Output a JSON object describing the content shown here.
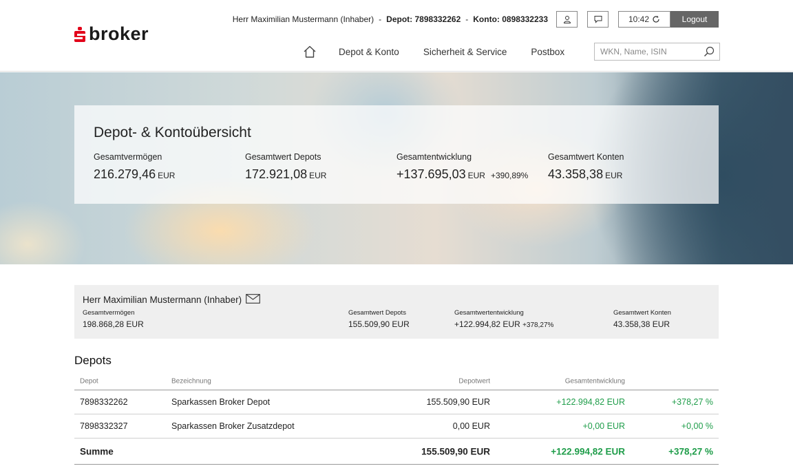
{
  "header": {
    "logo_text": "broker",
    "user_label": "Herr Maximilian Mustermann (Inhaber)",
    "depot_label": "Depot:",
    "depot_number": "7898332262",
    "konto_label": "Konto:",
    "konto_number": "0898332233",
    "separator": "-",
    "session_time": "10:42",
    "logout_label": "Logout",
    "nav": [
      "Depot & Konto",
      "Sicherheit & Service",
      "Postbox"
    ],
    "search_placeholder": "WKN, Name, ISIN"
  },
  "overview": {
    "title": "Depot- & Kontoübersicht",
    "metrics": [
      {
        "label": "Gesamtvermögen",
        "value": "216.279,46",
        "currency": "EUR"
      },
      {
        "label": "Gesamtwert Depots",
        "value": "172.921,08",
        "currency": "EUR"
      },
      {
        "label": "Gesamtentwicklung",
        "value": "+137.695,03",
        "currency": "EUR",
        "percent": "+390,89%"
      },
      {
        "label": "Gesamtwert Konten",
        "value": "43.358,38",
        "currency": "EUR"
      }
    ]
  },
  "owner": {
    "name": "Herr Maximilian Mustermann (Inhaber)",
    "metrics": [
      {
        "label": "Gesamtvermögen",
        "value": "198.868,28 EUR"
      },
      {
        "label": "Gesamtwert Depots",
        "value": "155.509,90 EUR"
      },
      {
        "label": "Gesamtwertentwicklung",
        "value": "+122.994,82 EUR",
        "percent": "+378,27%"
      },
      {
        "label": "Gesamtwert Konten",
        "value": "43.358,38 EUR"
      }
    ]
  },
  "depots": {
    "title": "Depots",
    "columns": [
      "Depot",
      "Bezeichnung",
      "Depotwert",
      "Gesamtentwicklung"
    ],
    "rows": [
      {
        "depot": "7898332262",
        "bezeichnung": "Sparkassen Broker Depot",
        "wert": "155.509,90 EUR",
        "entwicklung": "+122.994,82 EUR",
        "prozent": "+378,27 %"
      },
      {
        "depot": "7898332327",
        "bezeichnung": "Sparkassen Broker Zusatzdepot",
        "wert": "0,00 EUR",
        "entwicklung": "+0,00 EUR",
        "prozent": "+0,00 %"
      }
    ],
    "sum": {
      "label": "Summe",
      "wert": "155.509,90 EUR",
      "entwicklung": "+122.994,82 EUR",
      "prozent": "+378,27 %"
    }
  },
  "colors": {
    "brand_red": "#e2001a",
    "positive_green": "#1f9d4a",
    "logout_bg": "#666666"
  }
}
